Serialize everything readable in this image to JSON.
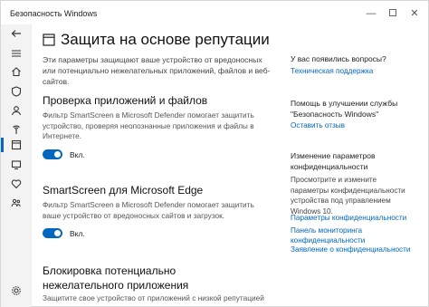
{
  "window": {
    "title": "Безопасность Windows"
  },
  "sidebar": {
    "items": [
      {
        "icon": "back-arrow-icon"
      },
      {
        "icon": "menu-icon"
      },
      {
        "icon": "home-icon"
      },
      {
        "icon": "shield-icon"
      },
      {
        "icon": "account-icon"
      },
      {
        "icon": "network-icon"
      },
      {
        "icon": "app-browser-icon",
        "active": true
      },
      {
        "icon": "device-security-icon"
      },
      {
        "icon": "heart-health-icon"
      },
      {
        "icon": "family-icon"
      },
      {
        "icon": "settings-icon"
      }
    ]
  },
  "main": {
    "title": "Защита на основе репутации",
    "intro": "Эти параметры защищают ваше устройство от вредоносных или потенциально нежелательных приложений, файлов и веб-сайтов.",
    "sections": [
      {
        "title": "Проверка приложений и файлов",
        "description": "Фильтр SmartScreen в Microsoft Defender помогает защитить устройство, проверяя неопознанные приложения и файлы в Интернете.",
        "toggle_label": "Вкл."
      },
      {
        "title": "SmartScreen для Microsoft Edge",
        "description": "Фильтр SmartScreen в Microsoft Defender помогает защитить ваше устройство от вредоносных сайтов и загрузок.",
        "toggle_label": "Вкл."
      },
      {
        "title": "Блокировка потенциально нежелательного приложения",
        "description": "Защитите свое устройство от приложений с низкой репутацией"
      }
    ]
  },
  "right_panel": {
    "questions": {
      "title": "У вас появились вопросы?",
      "link": "Техническая поддержка"
    },
    "improve": {
      "title": "Помощь в улучшении службы \"Безопасность Windows\"",
      "link": "Оставить отзыв"
    },
    "privacy": {
      "title": "Изменение параметров конфиденциальности",
      "text": "Просмотрите и измените параметры конфиденциальности устройства под управлением Windows 10.",
      "links": [
        "Параметры конфиденциальности",
        "Панель мониторинга конфиденциальности",
        "Заявление о конфиденциальности"
      ]
    }
  },
  "colors": {
    "accent": "#0067c0",
    "sidebar_bg": "#f3f3f3"
  }
}
